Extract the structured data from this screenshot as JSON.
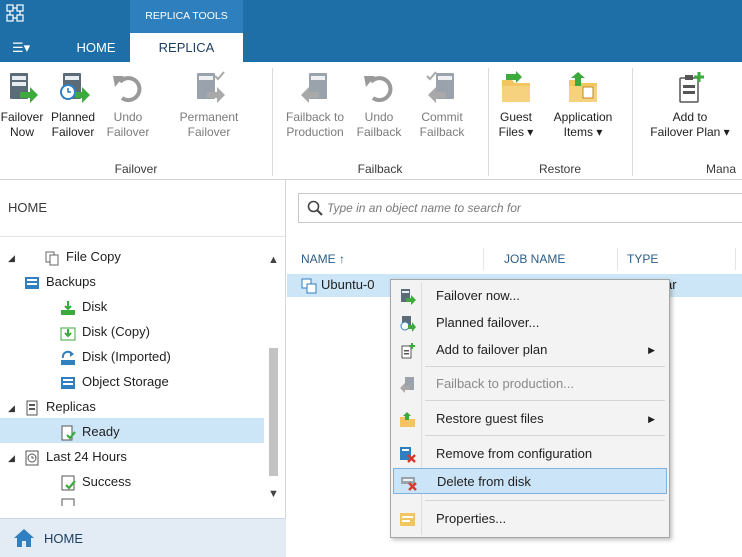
{
  "titlebar": {
    "context_tab_header": "REPLICA TOOLS",
    "file_menu_label": "☰▾",
    "tabs": [
      {
        "label": "HOME",
        "active": false
      },
      {
        "label": "REPLICA",
        "active": true
      }
    ]
  },
  "ribbon": {
    "groups": [
      {
        "label": "Failover",
        "buttons": [
          {
            "line1": "Failover",
            "line2": "Now",
            "enabled": true
          },
          {
            "line1": "Planned",
            "line2": "Failover",
            "enabled": true
          },
          {
            "line1": "Undo",
            "line2": "Failover",
            "enabled": false
          },
          {
            "line1": "Permanent",
            "line2": "Failover",
            "enabled": false
          }
        ]
      },
      {
        "label": "Failback",
        "buttons": [
          {
            "line1": "Failback to",
            "line2": "Production",
            "enabled": false
          },
          {
            "line1": "Undo",
            "line2": "Failback",
            "enabled": false
          },
          {
            "line1": "Commit",
            "line2": "Failback",
            "enabled": false
          }
        ]
      },
      {
        "label": "Restore",
        "buttons": [
          {
            "line1": "Guest",
            "line2": "Files ▾",
            "enabled": true
          },
          {
            "line1": "Application",
            "line2": "Items ▾",
            "enabled": true
          }
        ]
      },
      {
        "label": "Mana",
        "buttons": [
          {
            "line1": "Add to",
            "line2": "Failover Plan ▾",
            "enabled": true
          }
        ]
      }
    ]
  },
  "nav": {
    "header": "HOME",
    "tree": [
      {
        "label": "File Copy",
        "icon": "file-copy-icon",
        "expand": ""
      },
      {
        "label": "Backups",
        "icon": "backups-icon",
        "expand": "◢"
      },
      {
        "label": "Disk",
        "icon": "disk-icon",
        "expand": ""
      },
      {
        "label": "Disk (Copy)",
        "icon": "disk-copy-icon",
        "expand": ""
      },
      {
        "label": "Disk (Imported)",
        "icon": "disk-imported-icon",
        "expand": ""
      },
      {
        "label": "Object Storage",
        "icon": "object-storage-icon",
        "expand": ""
      },
      {
        "label": "Replicas",
        "icon": "replicas-icon",
        "expand": "◢"
      },
      {
        "label": "Ready",
        "icon": "ready-icon",
        "expand": ""
      },
      {
        "label": "Last 24 Hours",
        "icon": "last-24-hours-icon",
        "expand": "◢"
      },
      {
        "label": "Success",
        "icon": "success-icon",
        "expand": ""
      }
    ],
    "scroll_up": "▲",
    "scroll_down": "▼",
    "bottom_label": "HOME"
  },
  "search": {
    "placeholder": "Type in an object name to search for"
  },
  "table": {
    "columns": [
      "NAME ↑",
      "JOB NAME",
      "TYPE"
    ],
    "rows": [
      {
        "name": "Ubuntu-0",
        "type_fragment": "ar"
      }
    ]
  },
  "context_menu": {
    "items": [
      {
        "label": "Failover now...",
        "enabled": true,
        "submenu": false
      },
      {
        "label": "Planned failover...",
        "enabled": true,
        "submenu": false
      },
      {
        "label": "Add to failover plan",
        "enabled": true,
        "submenu": true
      },
      {
        "label": "Failback to production...",
        "enabled": false,
        "submenu": false
      },
      {
        "label": "Restore guest files",
        "enabled": true,
        "submenu": true
      },
      {
        "label": "Remove from configuration",
        "enabled": true,
        "submenu": false
      },
      {
        "label": "Delete from disk",
        "enabled": true,
        "submenu": false,
        "highlighted": true
      },
      {
        "label": "Properties...",
        "enabled": true,
        "submenu": false
      }
    ],
    "submenu_arrow": "▶"
  },
  "colors": {
    "titlebar": "#1e6fa8",
    "context_tab": "#2d80bd",
    "selection": "#cde6f7",
    "accent_green": "#3daa3d",
    "accent_blue": "#2f7fc1",
    "delete_red": "#d9372b"
  }
}
